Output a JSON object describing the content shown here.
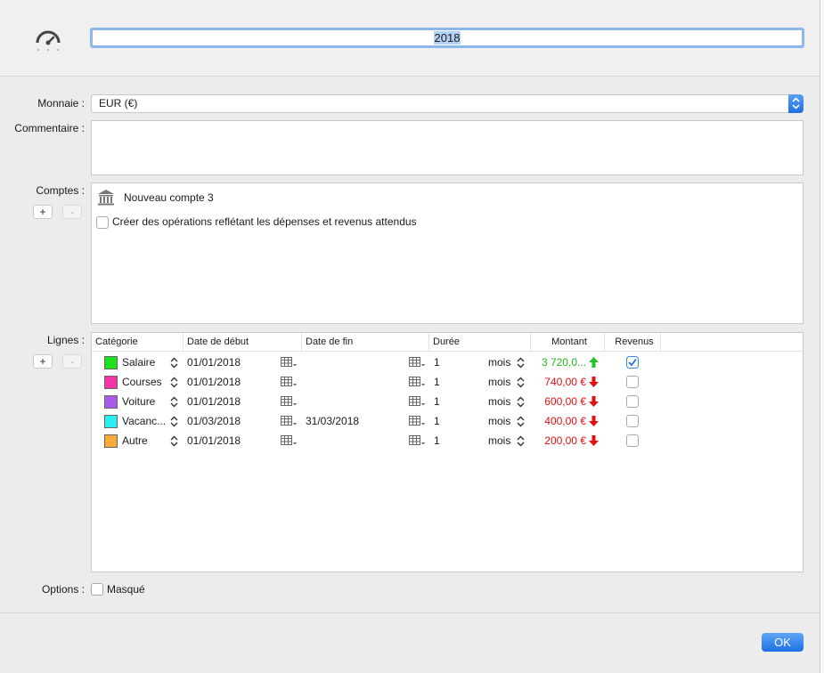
{
  "header": {
    "name_value": "2018"
  },
  "currency": {
    "label": "Monnaie :",
    "value": "EUR (€)"
  },
  "comment": {
    "label": "Commentaire :",
    "value": ""
  },
  "accounts": {
    "label": "Comptes :",
    "add": "+",
    "remove": "-",
    "account_name": "Nouveau compte 3",
    "create_ops_label": "Créer des opérations reflétant les dépenses et revenus attendus"
  },
  "lines": {
    "label": "Lignes :",
    "add": "+",
    "remove": "-",
    "columns": [
      "Catégorie",
      "Date de début",
      "Date de fin",
      "Durée",
      "Montant",
      "Revenus"
    ],
    "rows": [
      {
        "category": "Salaire",
        "color": "#1fe01f",
        "start": "01/01/2018",
        "end": "",
        "duration": "1",
        "unit": "mois",
        "amount": "3 720,0...",
        "amount_color": "#1db81d",
        "direction": "up",
        "income": true
      },
      {
        "category": "Courses",
        "color": "#f534a8",
        "start": "01/01/2018",
        "end": "",
        "duration": "1",
        "unit": "mois",
        "amount": "740,00 €",
        "amount_color": "#e01010",
        "direction": "down",
        "income": false
      },
      {
        "category": "Voiture",
        "color": "#a85ae8",
        "start": "01/01/2018",
        "end": "",
        "duration": "1",
        "unit": "mois",
        "amount": "600,00 €",
        "amount_color": "#e01010",
        "direction": "down",
        "income": false
      },
      {
        "category": "Vacanc...",
        "color": "#28f0f0",
        "start": "01/03/2018",
        "end": "31/03/2018",
        "duration": "1",
        "unit": "mois",
        "amount": "400,00 €",
        "amount_color": "#e01010",
        "direction": "down",
        "income": false
      },
      {
        "category": "Autre",
        "color": "#f9a83a",
        "start": "01/01/2018",
        "end": "",
        "duration": "1",
        "unit": "mois",
        "amount": "200,00 €",
        "amount_color": "#e01010",
        "direction": "down",
        "income": false
      }
    ]
  },
  "options": {
    "label": "Options :",
    "hidden_label": "Masqué"
  },
  "ok_label": "OK"
}
